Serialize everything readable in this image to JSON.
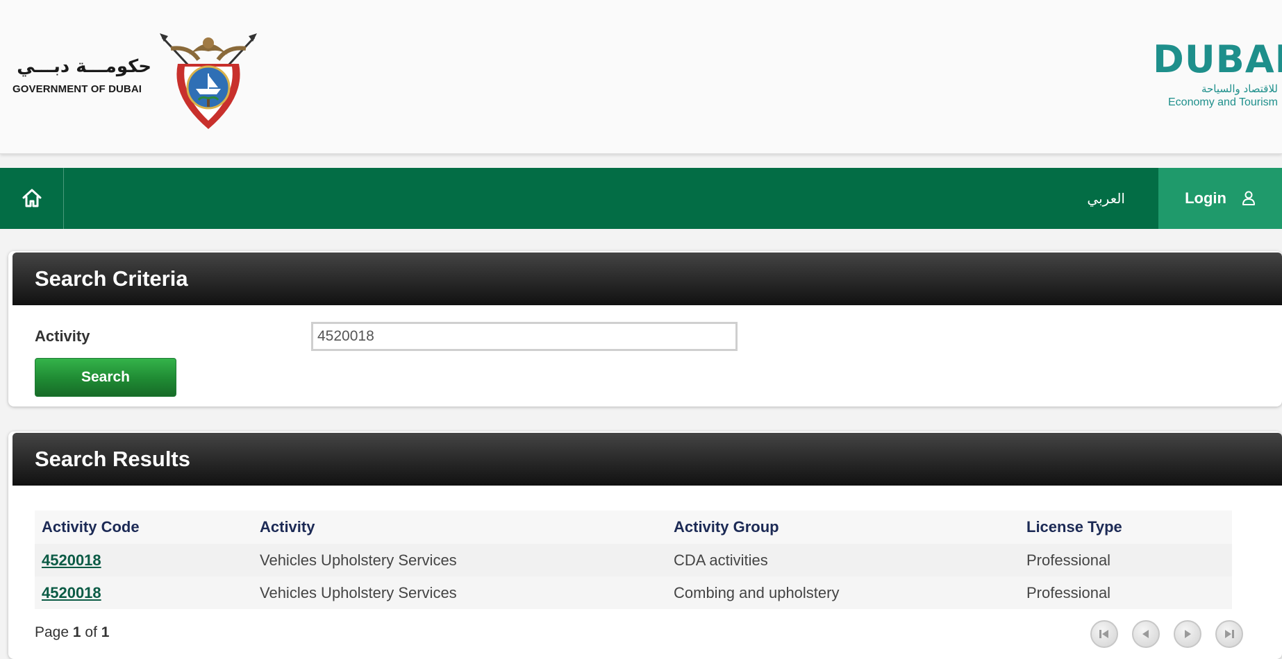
{
  "header": {
    "gov_arabic": "حكومـــة دبـــي",
    "gov_english": "GOVERNMENT OF DUBAI",
    "dubai_word": "DUBAI",
    "dubai_arabic": "للاقتصاد والسياحة",
    "dubai_english": "Economy and Tourism"
  },
  "nav": {
    "home_icon": "home-icon",
    "arabic_label": "العربي",
    "login_label": "Login",
    "login_icon": "user-icon",
    "bg_color": "#036d45",
    "login_color": "#1f9a6b"
  },
  "criteria": {
    "title": "Search Criteria",
    "activity_label": "Activity",
    "activity_value": "4520018",
    "search_label": "Search"
  },
  "results": {
    "title": "Search Results",
    "columns": [
      "Activity Code",
      "Activity",
      "Activity Group",
      "License Type"
    ],
    "rows": [
      {
        "code": "4520018",
        "activity": "Vehicles Upholstery Services",
        "group": "CDA activities",
        "license": "Professional"
      },
      {
        "code": "4520018",
        "activity": "Vehicles Upholstery Services",
        "group": "Combing and upholstery",
        "license": "Professional"
      }
    ],
    "pager": {
      "prefix": "Page",
      "current": "1",
      "of": "of",
      "total": "1"
    }
  }
}
